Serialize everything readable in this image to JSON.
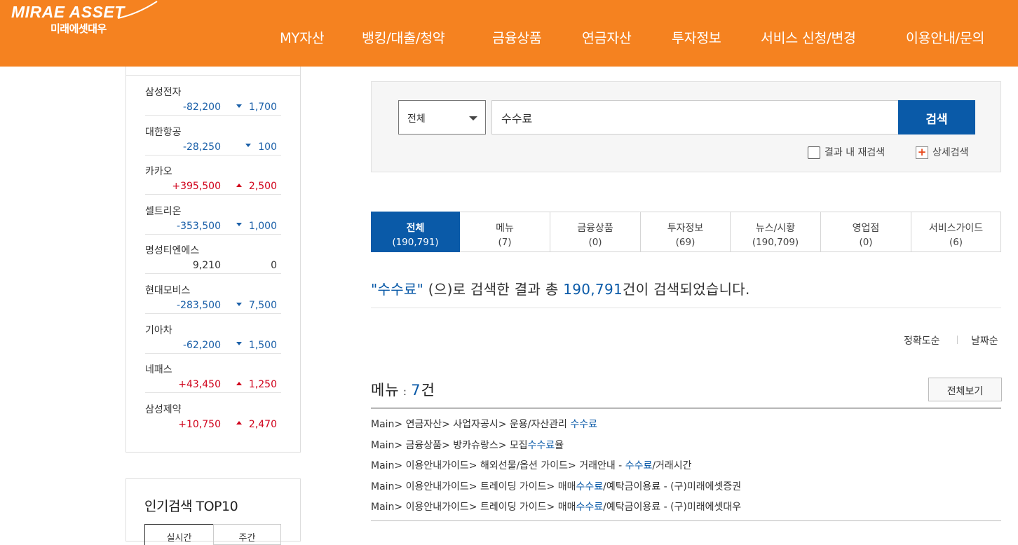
{
  "header": {
    "logo_en": "MIRAE ASSET",
    "logo_ko": "미래에셋대우",
    "nav": [
      "MY자산",
      "뱅킹/대출/청약",
      "금융상품",
      "연금자산",
      "투자정보",
      "서비스 신청/변경",
      "이용안내/문의"
    ]
  },
  "stocks": [
    {
      "name": "삼성전자",
      "price": "-82,200",
      "change": "1,700",
      "dir": "down"
    },
    {
      "name": "대한항공",
      "price": "-28,250",
      "change": "100",
      "dir": "down"
    },
    {
      "name": "카카오",
      "price": "+395,500",
      "change": "2,500",
      "dir": "up"
    },
    {
      "name": "셀트리온",
      "price": "-353,500",
      "change": "1,000",
      "dir": "down"
    },
    {
      "name": "명성티엔에스",
      "price": "9,210",
      "change": "0",
      "dir": "flat"
    },
    {
      "name": "현대모비스",
      "price": "-283,500",
      "change": "7,500",
      "dir": "down"
    },
    {
      "name": "기아차",
      "price": "-62,200",
      "change": "1,500",
      "dir": "down"
    },
    {
      "name": "네패스",
      "price": "+43,450",
      "change": "1,250",
      "dir": "up"
    },
    {
      "name": "삼성제약",
      "price": "+10,750",
      "change": "2,470",
      "dir": "up"
    }
  ],
  "popular": {
    "title": "인기검색 TOP10",
    "tabs": [
      "실시간",
      "주간"
    ]
  },
  "search": {
    "scope": "전체",
    "query": "수수료",
    "button": "검색",
    "option_recheck": "결과 내 재검색",
    "option_detail": "상세검색"
  },
  "tabs": [
    {
      "label": "전체",
      "count": "(190,791)",
      "active": true
    },
    {
      "label": "메뉴",
      "count": "(7)"
    },
    {
      "label": "금융상품",
      "count": "(0)"
    },
    {
      "label": "투자정보",
      "count": "(69)"
    },
    {
      "label": "뉴스/시황",
      "count": "(190,709)"
    },
    {
      "label": "영업점",
      "count": "(0)"
    },
    {
      "label": "서비스가이드",
      "count": "(6)"
    }
  ],
  "summary": {
    "keyword": "\"수수료\"",
    "mid": " (으)로 검색한 결과 총 ",
    "total": "190,791",
    "tail": "건이 검색되었습니다."
  },
  "sort": {
    "accuracy": "정확도순",
    "date": "날짜순"
  },
  "menu_section": {
    "title": "메뉴",
    "colon": " : ",
    "count": "7",
    "unit": "건",
    "view_all": "전체보기",
    "results": [
      {
        "pre": "Main> 연금자산> 사업자공시> 운용/자산관리 ",
        "kw": "수수료",
        "post": ""
      },
      {
        "pre": "Main> 금융상품> 방카슈랑스> 모집",
        "kw": "수수료",
        "post": "율"
      },
      {
        "pre": "Main> 이용안내가이드> 해외선물/옵션 가이드> 거래안내 - ",
        "kw": "수수료",
        "post": "/거래시간"
      },
      {
        "pre": "Main> 이용안내가이드> 트레이딩 가이드> 매매",
        "kw": "수수료",
        "post": "/예탁금이용료 - (구)미래에셋증권"
      },
      {
        "pre": "Main> 이용안내가이드> 트레이딩 가이드> 매매",
        "kw": "수수료",
        "post": "/예탁금이용료 - (구)미래에셋대우"
      }
    ]
  },
  "colors": {
    "brand_orange": "#f58220",
    "accent_blue": "#0a5aa8",
    "up_red": "#d0021b",
    "down_blue": "#1a5fa8"
  }
}
